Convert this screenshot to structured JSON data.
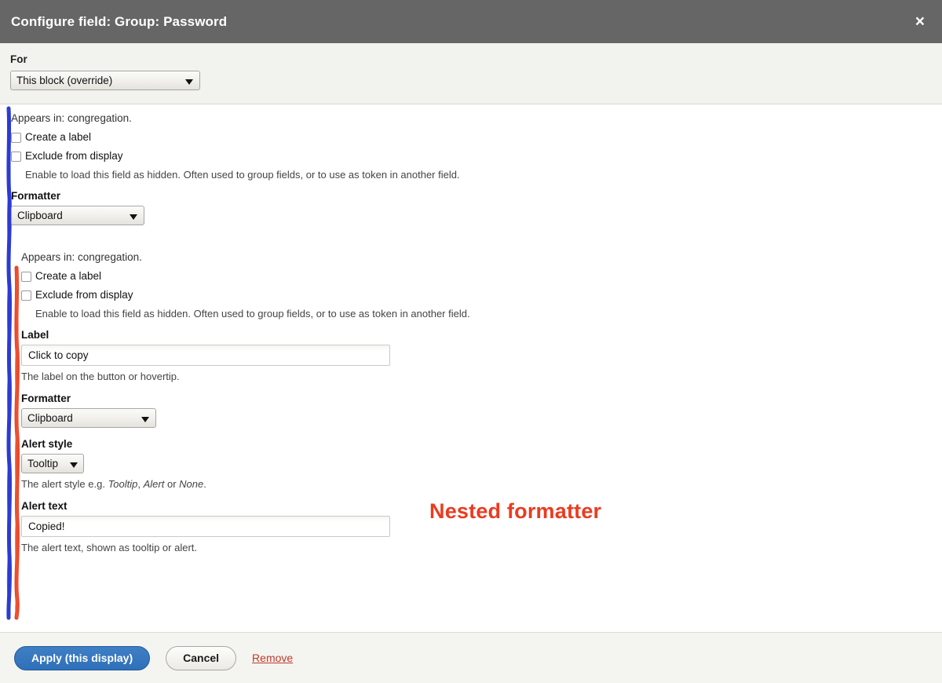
{
  "titlebar": {
    "title": "Configure field: Group: Password",
    "close_label": "×"
  },
  "for_section": {
    "label": "For",
    "select_value": "This block (override)"
  },
  "outer_formatter": {
    "appears_in": "Appears in: congregation.",
    "create_label_checkbox": "Create a label",
    "exclude_checkbox": "Exclude from display",
    "exclude_description": "Enable to load this field as hidden. Often used to group fields, or to use as token in another field.",
    "formatter_label": "Formatter",
    "formatter_value": "Clipboard"
  },
  "nested_formatter": {
    "appears_in": "Appears in: congregation.",
    "create_label_checkbox": "Create a label",
    "exclude_checkbox": "Exclude from display",
    "exclude_description": "Enable to load this field as hidden. Often used to group fields, or to use as token in another field.",
    "label_label": "Label",
    "label_value": "Click to copy",
    "label_description": "The label on the button or hovertip.",
    "formatter_label": "Formatter",
    "formatter_value": "Clipboard",
    "alert_style_label": "Alert style",
    "alert_style_value": "Tooltip",
    "alert_style_description_prefix": "The alert style e.g. ",
    "alert_style_option_1": "Tooltip",
    "alert_style_sep_1": ", ",
    "alert_style_option_2": "Alert",
    "alert_style_sep_2": " or ",
    "alert_style_option_3": "None",
    "alert_style_description_suffix": ".",
    "alert_text_label": "Alert text",
    "alert_text_value": "Copied!",
    "alert_text_description": "The alert text, shown as tooltip or alert."
  },
  "annotations": {
    "nested_formatter_callout": "Nested formatter",
    "outer_bracket_color": "#2233cc",
    "nested_bracket_color": "#eb3b20"
  },
  "footer": {
    "apply_label": "Apply (this display)",
    "cancel_label": "Cancel",
    "remove_label": "Remove"
  }
}
